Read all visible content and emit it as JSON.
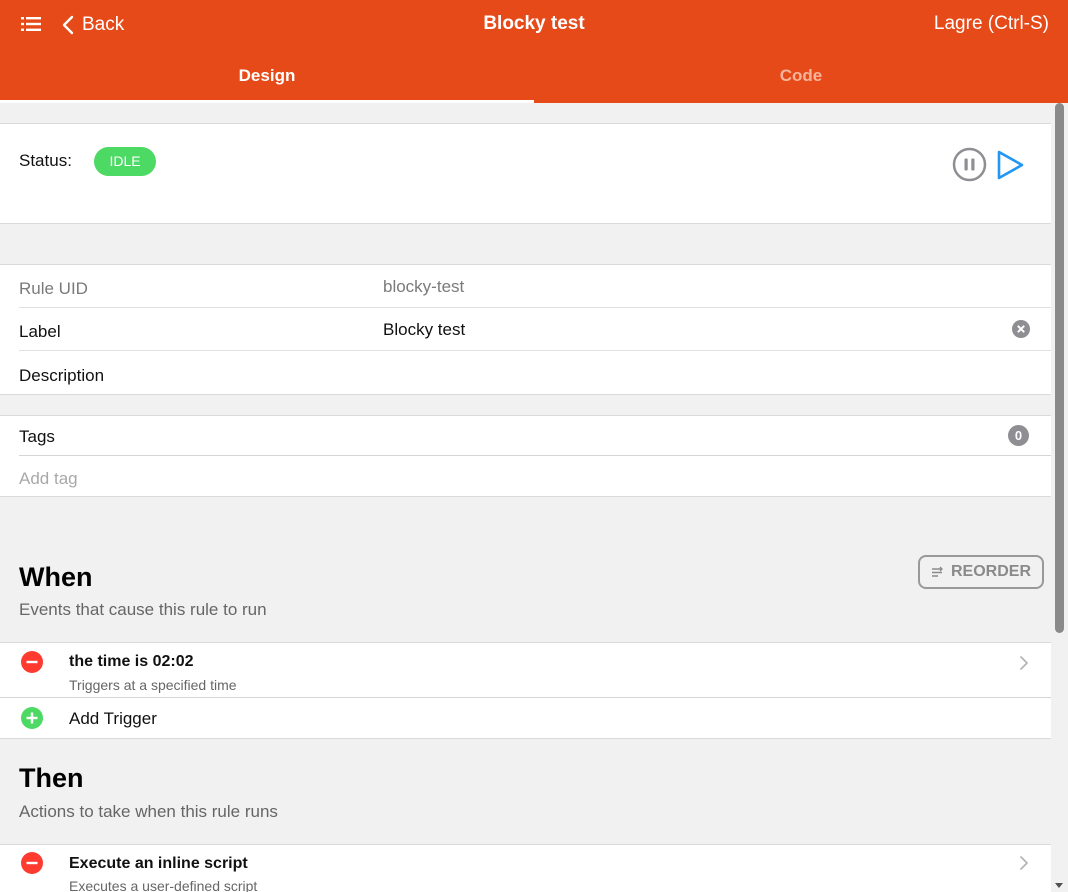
{
  "navbar": {
    "menu_icon": "list-icon",
    "back_label": "Back",
    "title": "Blocky test",
    "save_label": "Lagre (Ctrl-S)",
    "brand_color": "#e64a19"
  },
  "tabs": [
    {
      "label": "Design",
      "active": true
    },
    {
      "label": "Code",
      "active": false
    }
  ],
  "status": {
    "label": "Status:",
    "badge": "IDLE",
    "badge_color": "#4cd964"
  },
  "info": {
    "uid_label": "Rule UID",
    "uid_value": "blocky-test",
    "label_label": "Label",
    "label_value": "Blocky test",
    "description_label": "Description"
  },
  "tags": {
    "label": "Tags",
    "count": "0",
    "add_placeholder": "Add tag"
  },
  "when": {
    "title": "When",
    "subtitle": "Events that cause this rule to run",
    "reorder_label": "REORDER",
    "items": [
      {
        "title": "the time is 02:02",
        "subtitle": "Triggers at a specified time"
      }
    ],
    "add_label": "Add Trigger"
  },
  "then": {
    "title": "Then",
    "subtitle": "Actions to take when this rule runs",
    "items": [
      {
        "title": "Execute an inline script",
        "subtitle": "Executes a user-defined script"
      }
    ]
  }
}
